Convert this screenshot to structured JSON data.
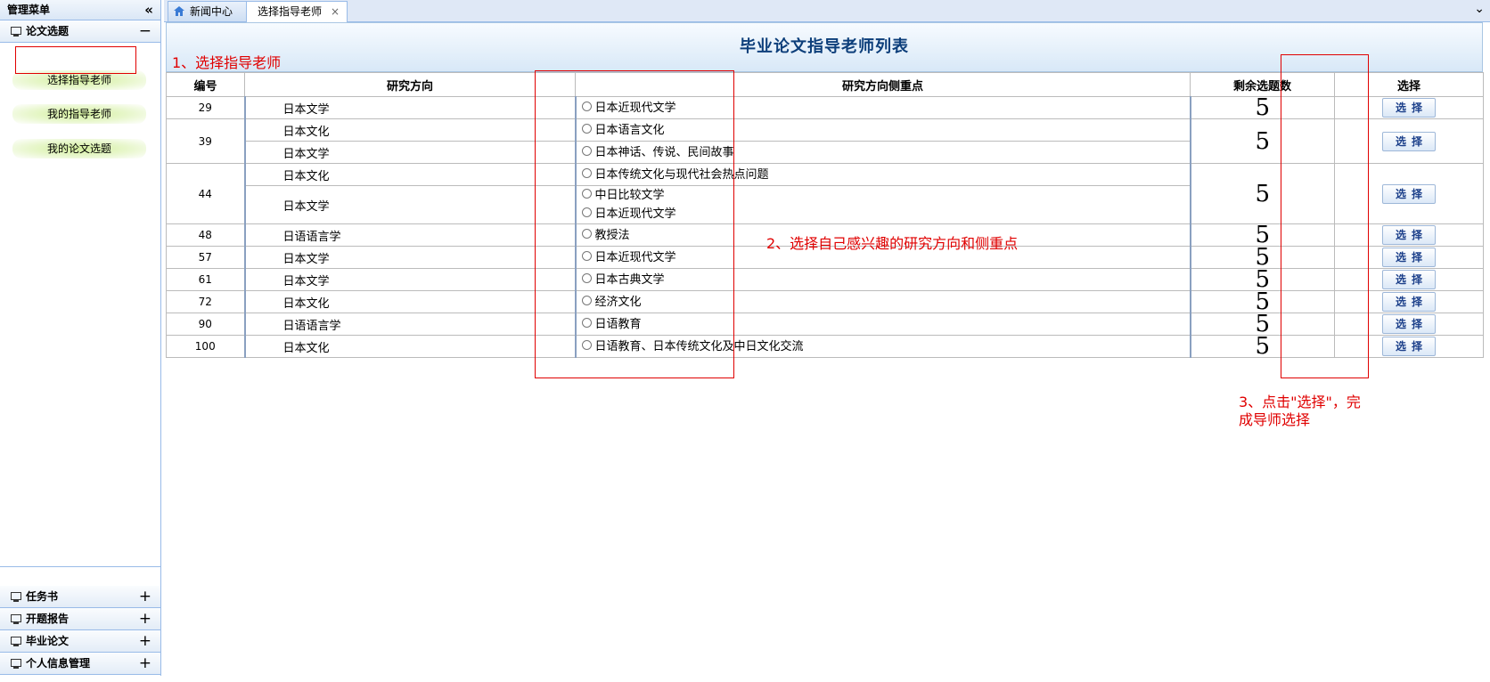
{
  "sidebar": {
    "title": "管理菜单",
    "collapse_glyph": "«",
    "sections": [
      {
        "label": "论文选题",
        "toggle": "−"
      },
      {
        "label": "任务书",
        "toggle": "+"
      },
      {
        "label": "开题报告",
        "toggle": "+"
      },
      {
        "label": "毕业论文",
        "toggle": "+"
      },
      {
        "label": "个人信息管理",
        "toggle": "+"
      }
    ],
    "links": [
      "选择指导老师",
      "我的指导老师",
      "我的论文选题"
    ]
  },
  "tabs": [
    {
      "label": "新闻中心",
      "icon": "home-icon"
    },
    {
      "label": "选择指导老师",
      "close": "×"
    }
  ],
  "tab_scroll": "⌄",
  "page": {
    "title": "毕业论文指导老师列表",
    "columns": [
      "编号",
      "研究方向",
      "研究方向侧重点",
      "剩余选题数",
      "选择"
    ],
    "select_label": "选择",
    "rows": [
      {
        "id": "29",
        "count": "5",
        "directions": [
          {
            "dir": "日本文学",
            "focus": [
              "日本近现代文学"
            ]
          }
        ]
      },
      {
        "id": "39",
        "count": "5",
        "directions": [
          {
            "dir": "日本文化",
            "focus": [
              "日本语言文化"
            ]
          },
          {
            "dir": "日本文学",
            "focus": [
              "日本神话、传说、民间故事"
            ]
          }
        ]
      },
      {
        "id": "44",
        "count": "5",
        "directions": [
          {
            "dir": "日本文化",
            "focus": [
              "日本传统文化与现代社会热点问题"
            ]
          },
          {
            "dir": "日本文学",
            "focus": [
              "中日比较文学",
              "日本近现代文学"
            ]
          }
        ]
      },
      {
        "id": "48",
        "count": "5",
        "directions": [
          {
            "dir": "日语语言学",
            "focus": [
              "教授法"
            ]
          }
        ]
      },
      {
        "id": "57",
        "count": "5",
        "directions": [
          {
            "dir": "日本文学",
            "focus": [
              "日本近现代文学"
            ]
          }
        ]
      },
      {
        "id": "61",
        "count": "5",
        "directions": [
          {
            "dir": "日本文学",
            "focus": [
              "日本古典文学"
            ]
          }
        ]
      },
      {
        "id": "72",
        "count": "5",
        "directions": [
          {
            "dir": "日本文化",
            "focus": [
              "经济文化"
            ]
          }
        ]
      },
      {
        "id": "90",
        "count": "5",
        "directions": [
          {
            "dir": "日语语言学",
            "focus": [
              "日语教育"
            ]
          }
        ]
      },
      {
        "id": "100",
        "count": "5",
        "directions": [
          {
            "dir": "日本文化",
            "focus": [
              "日语教育、日本传统文化及中日文化交流"
            ]
          }
        ]
      }
    ]
  },
  "annotations": {
    "step1": "1、选择指导老师",
    "step2": "2、选择自己感兴趣的研究方向和侧重点",
    "step3_line1": "3、点击\"选择\"，完",
    "step3_line2": "成导师选择",
    "color": "#e00000"
  }
}
